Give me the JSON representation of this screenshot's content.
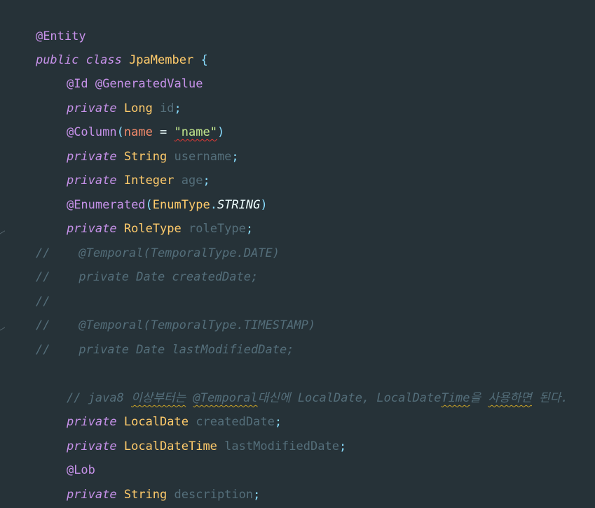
{
  "editor": {
    "lines": [
      {
        "id": "l1",
        "tokens": [
          "@Entity"
        ]
      },
      {
        "id": "l2",
        "tokens": [
          "public",
          " ",
          "class",
          " ",
          "JpaMember",
          " ",
          "{"
        ]
      },
      {
        "id": "l3",
        "tokens": [
          "@Id",
          " ",
          "@GeneratedValue"
        ]
      },
      {
        "id": "l4",
        "tokens": [
          "private",
          " ",
          "Long",
          " ",
          "id",
          ";"
        ]
      },
      {
        "id": "l5",
        "tokens": [
          "@Column",
          "(",
          "name",
          " = ",
          "\"name\"",
          ")"
        ]
      },
      {
        "id": "l6",
        "tokens": [
          "private",
          " ",
          "String",
          " ",
          "username",
          ";"
        ]
      },
      {
        "id": "l7",
        "tokens": [
          "private",
          " ",
          "Integer",
          " ",
          "age",
          ";"
        ]
      },
      {
        "id": "l8",
        "tokens": [
          "@Enumerated",
          "(",
          "EnumType",
          ".",
          "STRING",
          ")"
        ]
      },
      {
        "id": "l9",
        "tokens": [
          "private",
          " ",
          "RoleType",
          " ",
          "roleType",
          ";"
        ]
      },
      {
        "id": "l10",
        "tokens": [
          "//    @Temporal(TemporalType.DATE)"
        ]
      },
      {
        "id": "l11",
        "tokens": [
          "//    private Date createdDate;"
        ]
      },
      {
        "id": "l12",
        "tokens": [
          "//"
        ]
      },
      {
        "id": "l13",
        "tokens": [
          "//    @Temporal(TemporalType.TIMESTAMP)"
        ]
      },
      {
        "id": "l14",
        "tokens": [
          "//    private Date lastModifiedDate;"
        ]
      },
      {
        "id": "l15",
        "tokens": []
      },
      {
        "id": "l16",
        "tokens": [
          "// java8 ",
          "이상부터는",
          " ",
          "@Temporal",
          "대신에",
          " LocalDate, LocalDate",
          "Time",
          "을",
          " ",
          "사용하면",
          " 된다."
        ]
      },
      {
        "id": "l17",
        "tokens": [
          "private",
          " ",
          "LocalDate",
          " ",
          "createdDate",
          ";"
        ]
      },
      {
        "id": "l18",
        "tokens": [
          "private",
          " ",
          "LocalDateTime",
          " ",
          "lastModifiedDate",
          ";"
        ]
      },
      {
        "id": "l19",
        "tokens": [
          "@Lob"
        ]
      },
      {
        "id": "l20",
        "tokens": [
          "private",
          " ",
          "String",
          " ",
          "description",
          ";"
        ]
      },
      {
        "id": "l21",
        "tokens": [
          "}"
        ]
      }
    ]
  },
  "colors": {
    "background": "#263238",
    "keyword": "#c792ea",
    "type": "#ffcb6b",
    "field": "#546e7a",
    "string": "#c3e88d",
    "param": "#f78c6c",
    "punct": "#89ddff",
    "comment": "#546e7a"
  },
  "icons": [
    "fold-marker-icon"
  ]
}
